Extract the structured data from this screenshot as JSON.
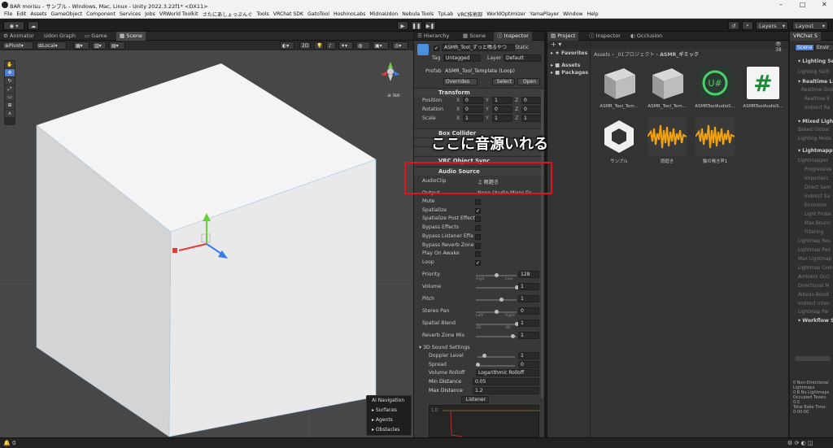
{
  "window": {
    "title": "BAR morisu - サンプル - Windows, Mac, Linux - Unity 2022.3.22f1* <DX11>"
  },
  "menu": [
    "File",
    "Edit",
    "Assets",
    "GameObject",
    "Component",
    "Services",
    "Jobs",
    "VRWorld Toolkit",
    "さたにあしょっぷんぐ",
    "Tools",
    "VRChat SDK",
    "GatoTool",
    "HoshinoLabs",
    "MidnaUdon",
    "Nebula Tools",
    "TpLab",
    "VRC技術部",
    "WorldOptimizer",
    "YamaPlayer",
    "Window",
    "Help"
  ],
  "toolbar": {
    "layers": "Layers",
    "layout": "Layout"
  },
  "scene_tabs": [
    "Animator",
    "Udon Graph",
    "Game",
    "Scene"
  ],
  "scene_toolbar": {
    "pivot": "Pivot",
    "local": "Local",
    "twod": "2D"
  },
  "gizmo": {
    "label": "Iso"
  },
  "ai_nav": {
    "title": "AI Navigation",
    "items": [
      "Surfaces",
      "Agents",
      "Obstacles"
    ]
  },
  "inspector_tabs": [
    "Hierarchy",
    "Scene",
    "Inspector"
  ],
  "inspector": {
    "object_name": "ASMR_Tool_ずっと鳴るやつ",
    "static_label": "Static",
    "tag_label": "Tag",
    "tag_value": "Untagged",
    "layer_label": "Layer",
    "layer_value": "Default",
    "prefab_label": "Prefab",
    "prefab_value": "ASMR_Tool_Template (Loop)",
    "overrides": "Overrides",
    "select": "Select",
    "open": "Open",
    "transform": {
      "title": "Transform",
      "rows": [
        {
          "label": "Position",
          "x": "0",
          "y": "1",
          "z": "0"
        },
        {
          "label": "Rotation",
          "x": "0",
          "y": "0",
          "z": "0"
        },
        {
          "label": "Scale",
          "x": "1",
          "y": "1",
          "z": "1"
        }
      ]
    },
    "components": [
      "Box Collider",
      "VRC Object Sync"
    ],
    "audio_source": {
      "title": "Audio Source",
      "audioclip_label": "AudioClip",
      "audioclip_value": "雨廻き",
      "output_label": "Output",
      "output_value": "None (Audio Mixer Gr",
      "toggles": [
        {
          "label": "Mute",
          "checked": false
        },
        {
          "label": "Spatialize",
          "checked": true
        },
        {
          "label": "Spatialize Post Effect",
          "checked": false
        },
        {
          "label": "Bypass Effects",
          "checked": false
        },
        {
          "label": "Bypass Listener Effe",
          "checked": false
        },
        {
          "label": "Bypass Reverb Zone",
          "checked": false
        },
        {
          "label": "Play On Awake",
          "checked": false
        },
        {
          "label": "Loop",
          "checked": true
        }
      ],
      "sliders": [
        {
          "label": "Priority",
          "value": "128",
          "fraction": 0.5,
          "lo": "High",
          "hi": "Low"
        },
        {
          "label": "Volume",
          "value": "1",
          "fraction": 1.0,
          "lo": "",
          "hi": ""
        },
        {
          "label": "Pitch",
          "value": "1",
          "fraction": 0.62,
          "lo": "",
          "hi": ""
        },
        {
          "label": "Stereo Pan",
          "value": "0",
          "fraction": 0.5,
          "lo": "Left",
          "hi": "Right"
        },
        {
          "label": "Spatial Blend",
          "value": "1",
          "fraction": 1.0,
          "lo": "2D",
          "hi": "3D"
        },
        {
          "label": "Reverb Zone Mix",
          "value": "1",
          "fraction": 0.9,
          "lo": "",
          "hi": ""
        }
      ],
      "sound3d": {
        "title": "3D Sound Settings",
        "doppler_label": "Doppler Level",
        "doppler_value": "1",
        "spread_label": "Spread",
        "spread_value": "0",
        "rolloff_label": "Volume Rolloff",
        "rolloff_value": "Logarithmic Rolloff",
        "min_label": "Min Distance",
        "min_value": "0.05",
        "max_label": "Max Distance",
        "max_value": "1.2",
        "listener": "Listener",
        "graph_tick": "1.0"
      }
    }
  },
  "project_tabs": [
    "Project",
    "Inspector",
    "Occlusion"
  ],
  "project": {
    "favorites": "Favorites",
    "tree": [
      "Assets",
      "Packages"
    ],
    "breadcrumb": [
      "Assets",
      "_01プロジェクト",
      "ASMR_ギミック"
    ],
    "count": "38",
    "assets": [
      {
        "name": "ASMR_Tool_Tem...",
        "kind": "cube"
      },
      {
        "name": "ASMR_Tool_Tem...",
        "kind": "cube"
      },
      {
        "name": "ASMRToolAudioS...",
        "kind": "udon"
      },
      {
        "name": "ASMRToolAudioS...",
        "kind": "cs"
      },
      {
        "name": "サンプル",
        "kind": "unity"
      },
      {
        "name": "雨廻き",
        "kind": "audio"
      },
      {
        "name": "猫の鳴き声1",
        "kind": "audio"
      }
    ]
  },
  "lighting": {
    "tab": "VRChat S",
    "subtabs": [
      "Scene",
      "Envir"
    ],
    "sections": [
      "Lighting Setti",
      "Realtime Lig",
      "Mixed Lighti",
      "Lightmapping",
      "Workflow Se"
    ],
    "items": [
      "Lighting Setti",
      "Realtime Glob",
      "Realtime E",
      "Indirect Re",
      "Baked Global",
      "Lighting Mode",
      "Lightmapper",
      "Progressive",
      "Importanc",
      "Direct Sam",
      "Indirect Sa",
      "Environm",
      "Light Probe",
      "Max Bounc",
      "Filtering",
      "Lightmap Res",
      "Lightmap Pad",
      "Max Lightmap",
      "Lightmap Com",
      "Ambient Occl",
      "Directional M",
      "Albedo Boost",
      "Indirect Inten",
      "Lightmap Par"
    ],
    "stats": [
      "0 Non-Directional Lightmaps",
      "0 B No Lightmaps",
      "Occupied Texels: 0.0",
      "Total Bake Time: 0:00:00"
    ]
  },
  "status": {
    "value": "0"
  },
  "annotation": {
    "text": "ここに音源いれる"
  },
  "colors": {
    "accent": "#4c7fd8",
    "highlight": "#e3121b"
  }
}
